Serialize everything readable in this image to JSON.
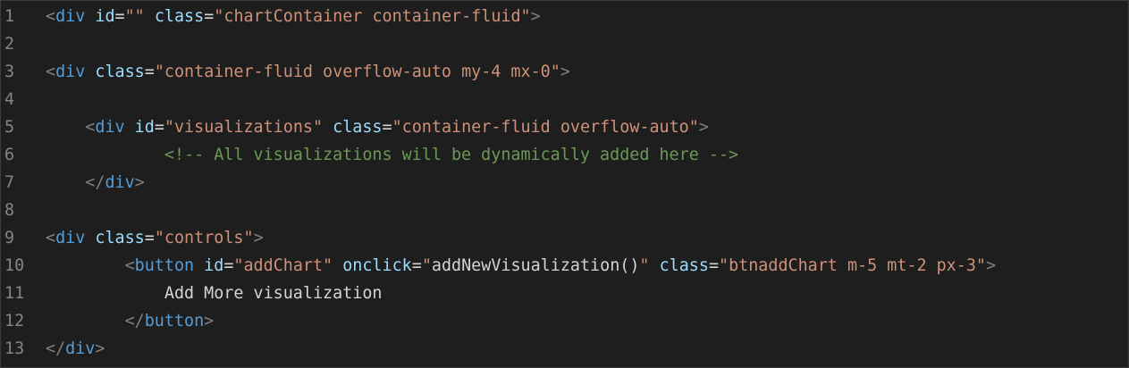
{
  "lines": [
    {
      "n": "1",
      "tokens": [
        {
          "t": "<",
          "c": "punct"
        },
        {
          "t": "div",
          "c": "tag"
        },
        {
          "t": " ",
          "c": "text"
        },
        {
          "t": "id",
          "c": "attr"
        },
        {
          "t": "=",
          "c": "eq"
        },
        {
          "t": "\"\"",
          "c": "str"
        },
        {
          "t": " ",
          "c": "text"
        },
        {
          "t": "class",
          "c": "attr"
        },
        {
          "t": "=",
          "c": "eq"
        },
        {
          "t": "\"chartContainer container-fluid\"",
          "c": "str"
        },
        {
          "t": ">",
          "c": "punct"
        }
      ]
    },
    {
      "n": "2",
      "tokens": []
    },
    {
      "n": "3",
      "tokens": [
        {
          "t": "<",
          "c": "punct"
        },
        {
          "t": "div",
          "c": "tag"
        },
        {
          "t": " ",
          "c": "text"
        },
        {
          "t": "class",
          "c": "attr"
        },
        {
          "t": "=",
          "c": "eq"
        },
        {
          "t": "\"container-fluid overflow-auto my-4 mx-0\"",
          "c": "str"
        },
        {
          "t": ">",
          "c": "punct"
        }
      ]
    },
    {
      "n": "4",
      "tokens": []
    },
    {
      "n": "5",
      "tokens": [
        {
          "t": "    ",
          "c": "text"
        },
        {
          "t": "<",
          "c": "punct"
        },
        {
          "t": "div",
          "c": "tag"
        },
        {
          "t": " ",
          "c": "text"
        },
        {
          "t": "id",
          "c": "attr"
        },
        {
          "t": "=",
          "c": "eq"
        },
        {
          "t": "\"visualizations\"",
          "c": "str"
        },
        {
          "t": " ",
          "c": "text"
        },
        {
          "t": "class",
          "c": "attr"
        },
        {
          "t": "=",
          "c": "eq"
        },
        {
          "t": "\"container-fluid overflow-auto\"",
          "c": "str"
        },
        {
          "t": ">",
          "c": "punct"
        }
      ]
    },
    {
      "n": "6",
      "tokens": [
        {
          "t": "            ",
          "c": "text"
        },
        {
          "t": "<!-- All visualizations will be dynamically added here -->",
          "c": "comment"
        }
      ]
    },
    {
      "n": "7",
      "tokens": [
        {
          "t": "    ",
          "c": "text"
        },
        {
          "t": "</",
          "c": "punct"
        },
        {
          "t": "div",
          "c": "tag"
        },
        {
          "t": ">",
          "c": "punct"
        }
      ]
    },
    {
      "n": "8",
      "tokens": []
    },
    {
      "n": "9",
      "tokens": [
        {
          "t": "<",
          "c": "punct"
        },
        {
          "t": "div",
          "c": "tag"
        },
        {
          "t": " ",
          "c": "text"
        },
        {
          "t": "class",
          "c": "attr"
        },
        {
          "t": "=",
          "c": "eq"
        },
        {
          "t": "\"controls\"",
          "c": "str"
        },
        {
          "t": ">",
          "c": "punct"
        }
      ]
    },
    {
      "n": "10",
      "tokens": [
        {
          "t": "        ",
          "c": "text"
        },
        {
          "t": "<",
          "c": "punct"
        },
        {
          "t": "button",
          "c": "tag"
        },
        {
          "t": " ",
          "c": "text"
        },
        {
          "t": "id",
          "c": "attr"
        },
        {
          "t": "=",
          "c": "eq"
        },
        {
          "t": "\"addChart\"",
          "c": "str"
        },
        {
          "t": " ",
          "c": "text"
        },
        {
          "t": "onclick",
          "c": "attr"
        },
        {
          "t": "=",
          "c": "eq"
        },
        {
          "t": "\"",
          "c": "str"
        },
        {
          "t": "addNewVisualization()",
          "c": "text"
        },
        {
          "t": "\"",
          "c": "str"
        },
        {
          "t": " ",
          "c": "text"
        },
        {
          "t": "class",
          "c": "attr"
        },
        {
          "t": "=",
          "c": "eq"
        },
        {
          "t": "\"btnaddChart m-5 mt-2 px-3\"",
          "c": "str"
        },
        {
          "t": ">",
          "c": "punct"
        }
      ]
    },
    {
      "n": "11",
      "tokens": [
        {
          "t": "            ",
          "c": "text"
        },
        {
          "t": "Add More visualization",
          "c": "text"
        }
      ]
    },
    {
      "n": "12",
      "tokens": [
        {
          "t": "        ",
          "c": "text"
        },
        {
          "t": "</",
          "c": "punct"
        },
        {
          "t": "button",
          "c": "tag"
        },
        {
          "t": ">",
          "c": "punct"
        }
      ]
    },
    {
      "n": "13",
      "tokens": [
        {
          "t": "</",
          "c": "punct"
        },
        {
          "t": "div",
          "c": "tag"
        },
        {
          "t": ">",
          "c": "punct"
        }
      ]
    }
  ]
}
